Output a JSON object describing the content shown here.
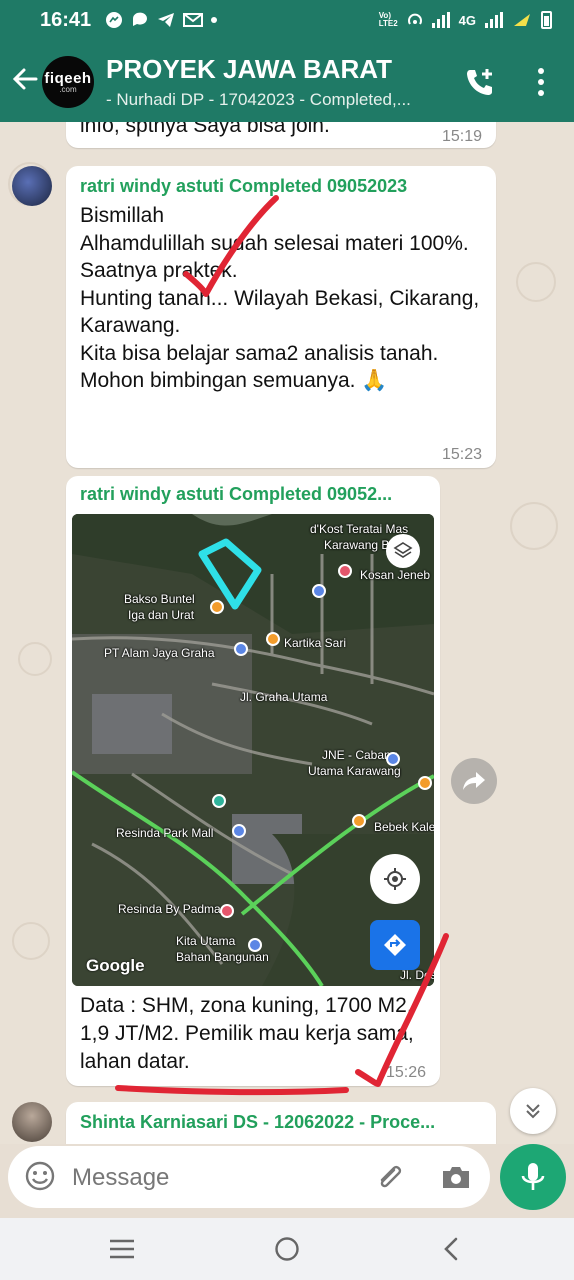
{
  "status_bar": {
    "time": "16:41",
    "network_label": "4G",
    "volte_label": "Vo)\nLTE2"
  },
  "header": {
    "avatar_logo_main": "fiqeeh",
    "avatar_logo_sub": ".com",
    "title": "PROYEK JAWA BARAT",
    "subtitle": "- Nurhadi DP - 17042023 - Completed,..."
  },
  "chat": {
    "messages": [
      {
        "text": "info, sptnya Saya bisa join.",
        "time": "15:19"
      },
      {
        "sender": "ratri windy astuti Completed 09052023",
        "text": "Bismillah\nAlhamdulillah sudah selesai materi 100%.\nSaatnya praktek.\nHunting tanah... Wilayah Bekasi, Cikarang, Karawang.\nKita bisa belajar sama2 analisis tanah.\nMohon bimbingan semuanya. 🙏",
        "time": "15:23"
      },
      {
        "sender": "ratri windy astuti Completed 09052...",
        "map_labels": [
          "d'Kost Teratai Mas",
          "Karawang Ba",
          "Kosan Jeneb",
          "Bakso Buntel",
          "Iga dan Urat",
          "PT Alam Jaya Graha",
          "Kartika Sari",
          "Jl. Graha Utama",
          "JNE - Cabang",
          "Utama Karawang",
          "Resinda Park Mall",
          "Bebek Kale",
          "Resinda By Padma",
          "Kita Utama",
          "Bahan Bangunan",
          "Jl. Desa"
        ],
        "map_brand": "Google",
        "text": "Data : SHM, zona kuning, 1700 M2, 1,9 JT/M2. Pemilik mau kerja sama, lahan datar.",
        "time": "15:26"
      },
      {
        "sender": "Shinta Karniasari DS - 12062022 - Proce..."
      }
    ]
  },
  "input": {
    "placeholder": "Message"
  },
  "colors": {
    "header": "#1f7a66",
    "sender": "#22a05c",
    "fab": "#1da774",
    "annotation": "#e02534"
  }
}
